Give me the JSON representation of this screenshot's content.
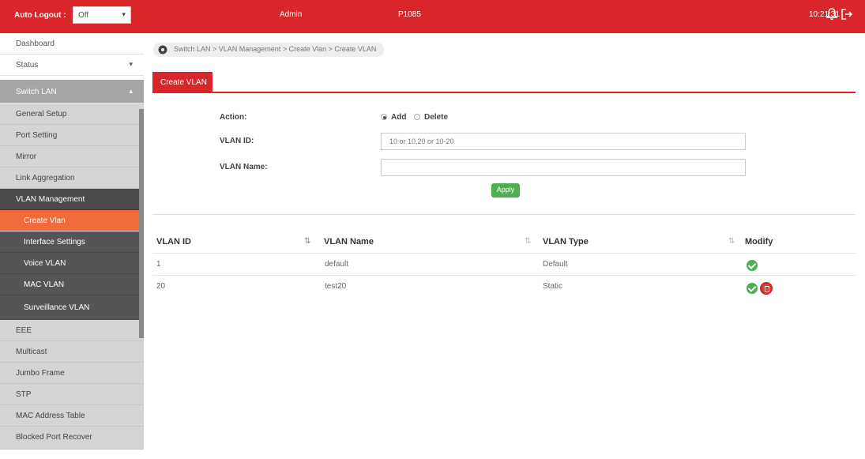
{
  "topbar": {
    "auto_logout_label": "Auto Logout :",
    "auto_logout_value": "Off",
    "user": "Admin",
    "model": "P1085",
    "time": "10:21:31",
    "accent": "#d8262a"
  },
  "sidebar": {
    "items": [
      {
        "label": "Dashboard"
      },
      {
        "label": "Status"
      },
      {
        "label": "Switch LAN"
      },
      {
        "label": "General Setup"
      },
      {
        "label": "Port Setting"
      },
      {
        "label": "Mirror"
      },
      {
        "label": "Link Aggregation"
      },
      {
        "label": "VLAN Management"
      },
      {
        "label": "Create Vlan"
      },
      {
        "label": "Interface Settings"
      },
      {
        "label": "Voice VLAN"
      },
      {
        "label": "MAC VLAN"
      },
      {
        "label": "Surveillance VLAN"
      },
      {
        "label": "EEE"
      },
      {
        "label": "Multicast"
      },
      {
        "label": "Jumbo Frame"
      },
      {
        "label": "STP"
      },
      {
        "label": "MAC Address Table"
      },
      {
        "label": "Blocked Port Recover"
      }
    ]
  },
  "breadcrumb": "Switch LAN > VLAN Management > Create Vlan > Create VLAN",
  "tab": "Create VLAN",
  "form": {
    "action_label": "Action:",
    "add_label": "Add",
    "delete_label": "Delete",
    "selected": "Add",
    "vlan_id_label": "VLAN ID:",
    "vlan_id_placeholder": "10 or 10,20 or 10-20",
    "vlan_name_label": "VLAN Name:",
    "vlan_name_value": "",
    "apply_label": "Apply"
  },
  "table": {
    "headers": [
      "VLAN ID",
      "VLAN Name",
      "VLAN Type",
      "Modify"
    ],
    "rows": [
      {
        "id": "1",
        "name": "default",
        "type": "Default",
        "actions": [
          "edit"
        ]
      },
      {
        "id": "20",
        "name": "test20",
        "type": "Static",
        "actions": [
          "edit",
          "delete"
        ]
      }
    ]
  }
}
